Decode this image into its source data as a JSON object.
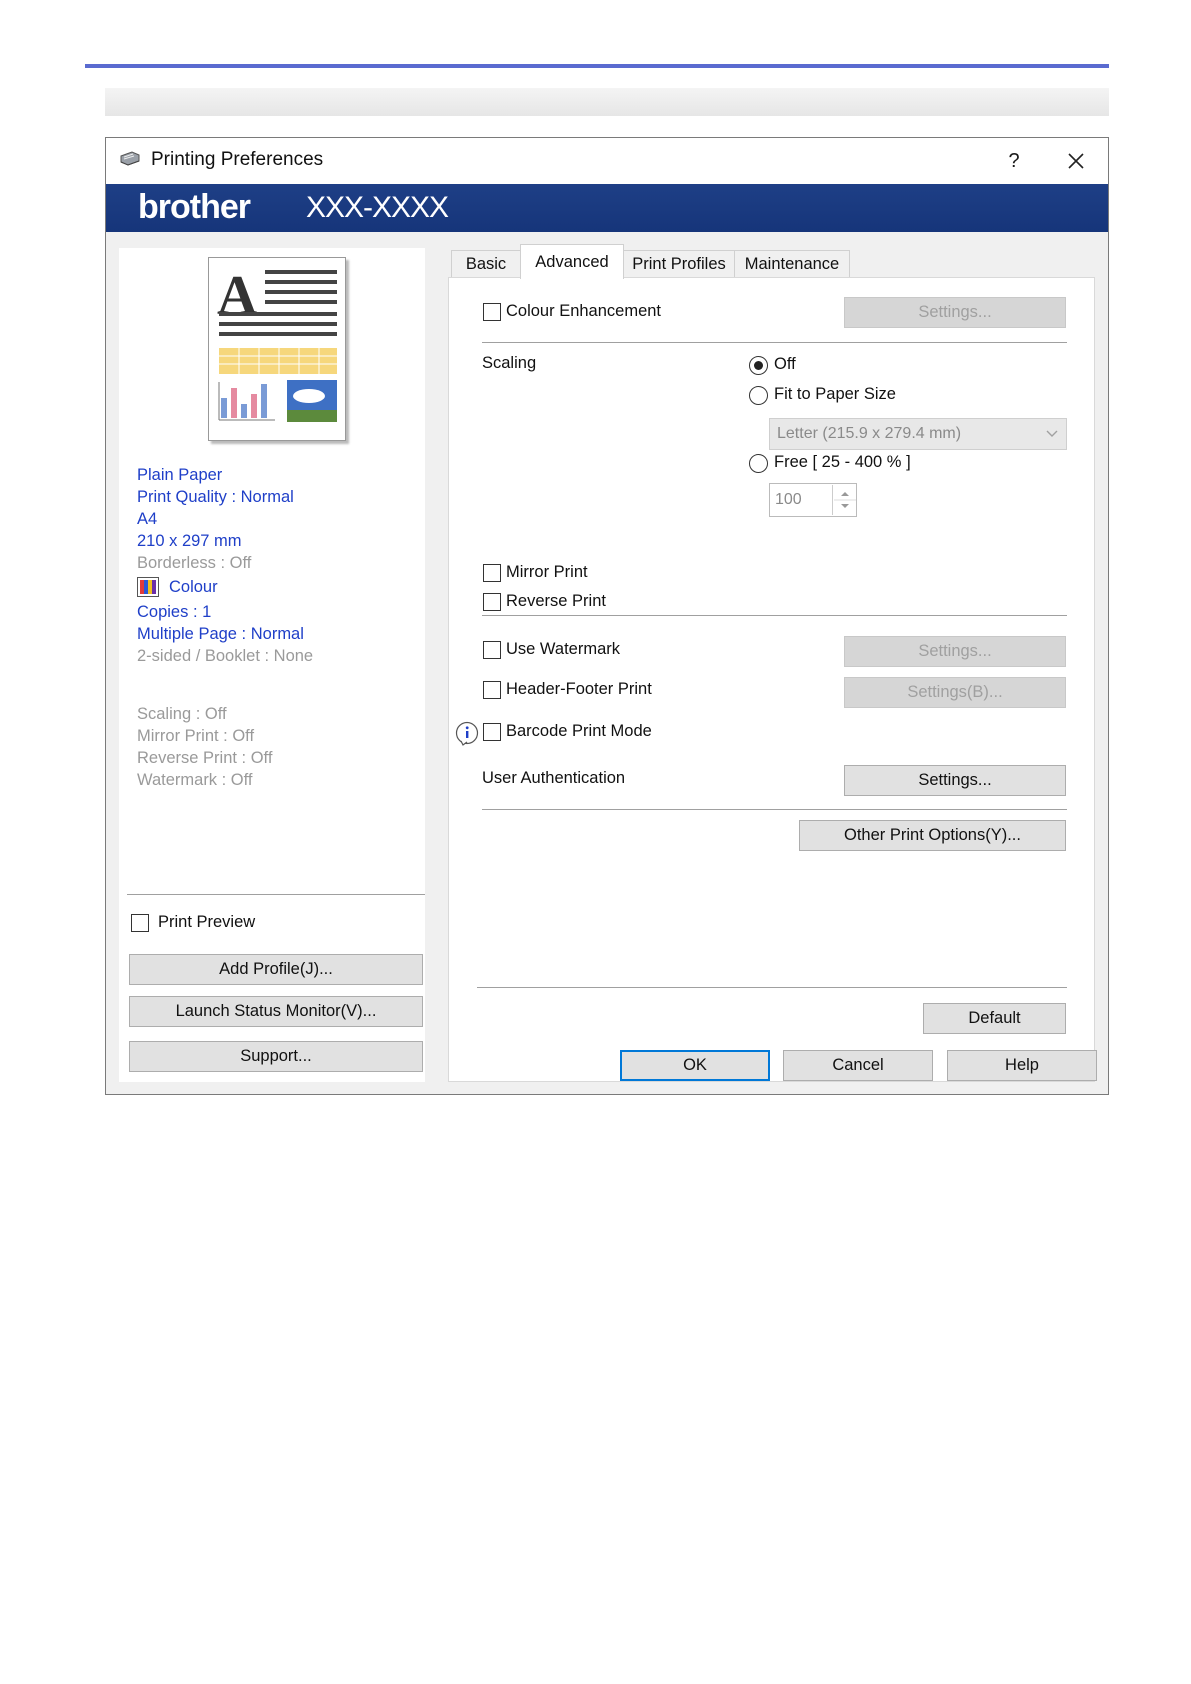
{
  "window": {
    "title": "Printing Preferences",
    "help_glyph": "?",
    "brand": "brother",
    "model": "XXX-XXXX"
  },
  "tabs": [
    {
      "label": "Basic"
    },
    {
      "label": "Advanced"
    },
    {
      "label": "Print Profiles"
    },
    {
      "label": "Maintenance"
    }
  ],
  "summary": {
    "media": "Plain Paper",
    "quality": "Print Quality : Normal",
    "size": "A4",
    "dims": "210 x 297 mm",
    "borderless": "Borderless : Off",
    "colour": "Colour",
    "copies": "Copies : 1",
    "multiple": "Multiple Page : Normal",
    "twosided": "2-sided / Booklet : None",
    "scaling": "Scaling : Off",
    "mirror": "Mirror Print : Off",
    "reverse": "Reverse Print : Off",
    "watermark": "Watermark : Off"
  },
  "left": {
    "print_preview": "Print Preview",
    "add_profile": "Add Profile(J)...",
    "status_monitor": "Launch Status Monitor(V)...",
    "support": "Support..."
  },
  "advanced": {
    "colour_enhancement": "Colour Enhancement",
    "settings": "Settings...",
    "scaling_label": "Scaling",
    "scaling_off": "Off",
    "fit_to_paper": "Fit to Paper Size",
    "paper_combo": "Letter (215.9 x 279.4 mm)",
    "free": "Free [ 25 - 400 % ]",
    "free_value": "100",
    "mirror_print": "Mirror Print",
    "reverse_print": "Reverse Print",
    "use_watermark": "Use Watermark",
    "header_footer": "Header-Footer Print",
    "settings_b": "Settings(B)...",
    "barcode": "Barcode Print Mode",
    "user_auth": "User Authentication",
    "other_options": "Other Print Options(Y)...",
    "default": "Default"
  },
  "footer": {
    "ok": "OK",
    "cancel": "Cancel",
    "help": "Help"
  }
}
